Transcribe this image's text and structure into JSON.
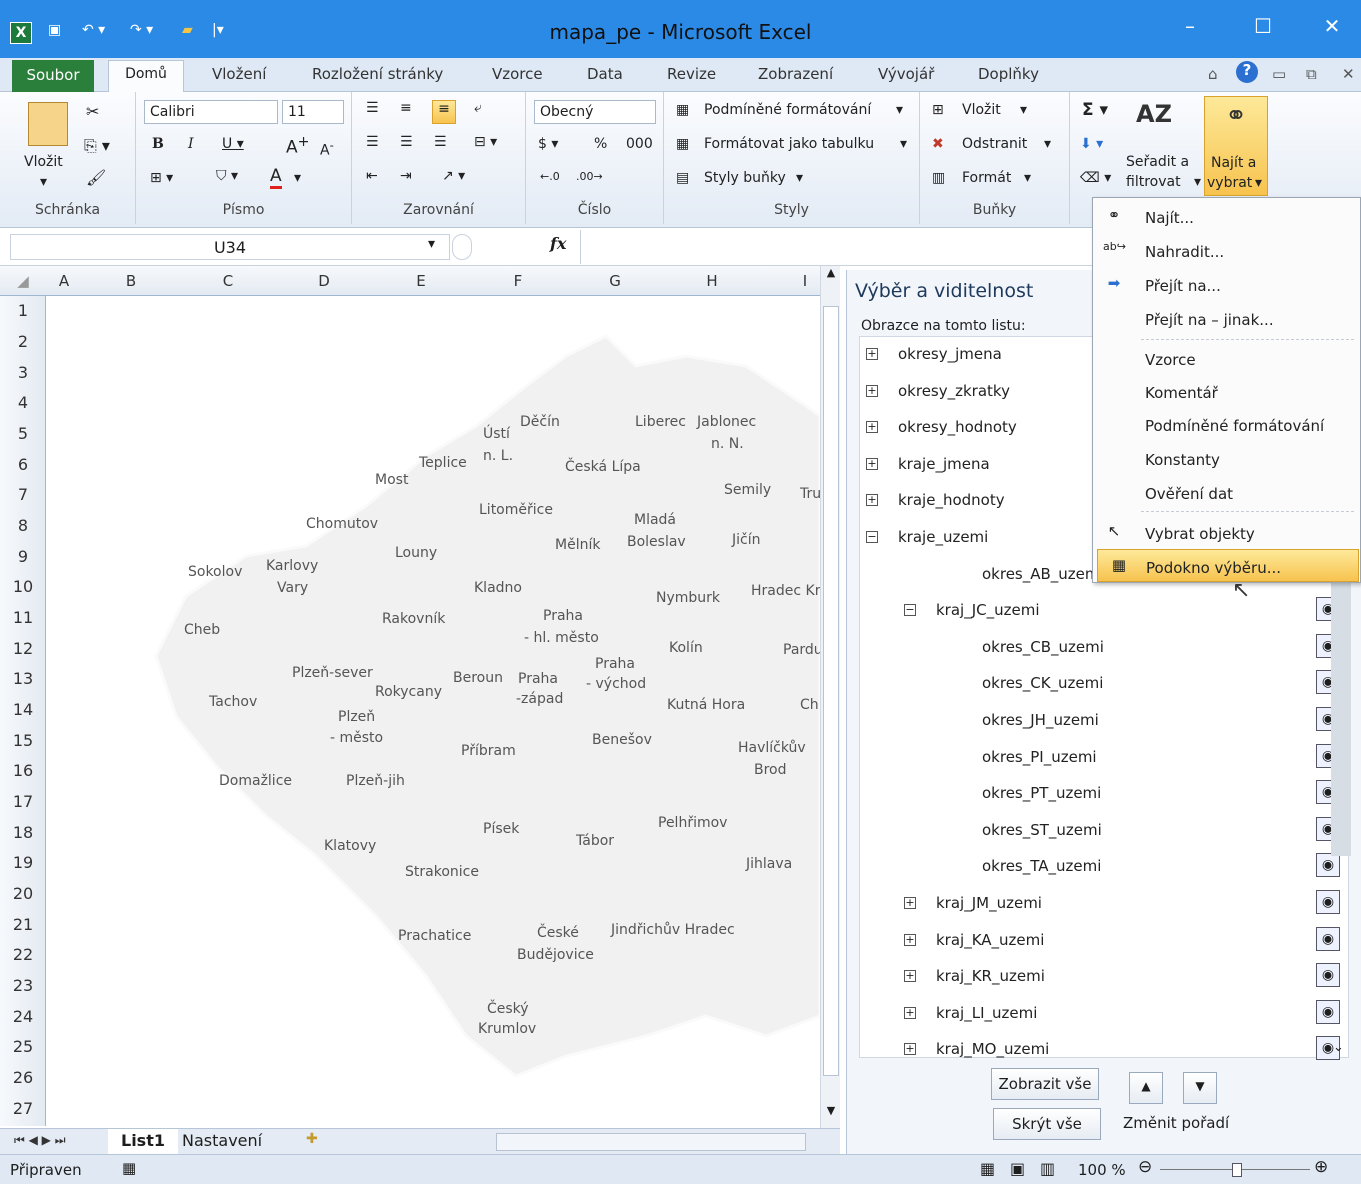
{
  "window": {
    "title": "mapa_pe  -  Microsoft Excel"
  },
  "tabs": [
    "Soubor",
    "Domů",
    "Vložení",
    "Rozložení stránky",
    "Vzorce",
    "Data",
    "Revize",
    "Zobrazení",
    "Vývojář",
    "Doplňky"
  ],
  "ribbon": {
    "clipboard": {
      "paste": "Vložit",
      "label": "Schránka"
    },
    "font": {
      "name": "Calibri",
      "size": "11",
      "label": "Písmo"
    },
    "alignment": {
      "label": "Zarovnání"
    },
    "number": {
      "format": "Obecný",
      "percent": "%",
      "thousands": "000",
      "label": "Číslo"
    },
    "styles": {
      "conditional": "Podmíněné formátování",
      "as_table": "Formátovat jako tabulku",
      "cell_styles": "Styly buňky",
      "label": "Styly"
    },
    "cells": {
      "insert": "Vložit",
      "delete": "Odstranit",
      "format": "Formát",
      "label": "Buňky"
    },
    "editing": {
      "sort_line1": "Seřadit a",
      "sort_line2": "filtrovat",
      "find_line1": "Najít a",
      "find_line2": "vybrat"
    }
  },
  "formula_bar": {
    "name_box": "U34",
    "fx": "fx"
  },
  "grid": {
    "columns": [
      "A",
      "B",
      "C",
      "D",
      "E",
      "F",
      "G",
      "H",
      "I"
    ],
    "rows": [
      "1",
      "2",
      "3",
      "4",
      "5",
      "6",
      "7",
      "8",
      "9",
      "10",
      "11",
      "12",
      "13",
      "14",
      "15",
      "16",
      "17",
      "18",
      "19",
      "20",
      "21",
      "22",
      "23",
      "24",
      "25",
      "26",
      "27"
    ]
  },
  "map_labels": [
    "Děčín",
    "Liberec",
    "Jablonec",
    "n. N.",
    "Ústí",
    "n. L.",
    "Teplice",
    "Česká Lípa",
    "Most",
    "Semily",
    "Tru",
    "Litoměřice",
    "Chomutov",
    "Mladá",
    "Boleslav",
    "Mělník",
    "Jičín",
    "Louny",
    "Karlovy",
    "Vary",
    "Sokolov",
    "Kladno",
    "Nymburk",
    "Hradec Kr",
    "Praha",
    "- hl. město",
    "Rakovník",
    "Cheb",
    "Kolín",
    "Pardu",
    "Praha",
    "- východ",
    "Plzeň-sever",
    "Beroun",
    "Praha",
    "-západ",
    "Rokycany",
    "Tachov",
    "Kutná Hora",
    "Ch",
    "Plzeň",
    "- město",
    "Benešov",
    "Příbram",
    "Havlíčkův",
    "Brod",
    "Domažlice",
    "Plzeň-jih",
    "Pelhřimov",
    "Písek",
    "Tábor",
    "Klatovy",
    "Jihlava",
    "Strakonice",
    "Prachatice",
    "České",
    "Budějovice",
    "Jindřichův Hradec",
    "Český",
    "Krumlov"
  ],
  "sheets": [
    "List1",
    "Nastavení"
  ],
  "status": {
    "ready": "Připraven",
    "zoom": "100 %"
  },
  "selection_pane": {
    "title": "Výběr a viditelnost",
    "subtitle": "Obrazce na tomto listu:",
    "items": [
      {
        "label": "okresy_jmena",
        "expander": "+"
      },
      {
        "label": "okresy_zkratky",
        "expander": "+"
      },
      {
        "label": "okresy_hodnoty",
        "expander": "+"
      },
      {
        "label": "kraje_jmena",
        "expander": "+"
      },
      {
        "label": "kraje_hodnoty",
        "expander": "+"
      },
      {
        "label": "kraje_uzemi",
        "expander": "−"
      },
      {
        "label": "okres_AB_uzemi",
        "expander": ""
      },
      {
        "label": "kraj_JC_uzemi",
        "expander": "−"
      },
      {
        "label": "okres_CB_uzemi",
        "expander": ""
      },
      {
        "label": "okres_CK_uzemi",
        "expander": ""
      },
      {
        "label": "okres_JH_uzemi",
        "expander": ""
      },
      {
        "label": "okres_PI_uzemi",
        "expander": ""
      },
      {
        "label": "okres_PT_uzemi",
        "expander": ""
      },
      {
        "label": "okres_ST_uzemi",
        "expander": ""
      },
      {
        "label": "okres_TA_uzemi",
        "expander": ""
      },
      {
        "label": "kraj_JM_uzemi",
        "expander": "+"
      },
      {
        "label": "kraj_KA_uzemi",
        "expander": "+"
      },
      {
        "label": "kraj_KR_uzemi",
        "expander": "+"
      },
      {
        "label": "kraj_LI_uzemi",
        "expander": "+"
      },
      {
        "label": "kraj_MO_uzemi",
        "expander": "+"
      }
    ],
    "show_all": "Zobrazit vše",
    "hide_all": "Skrýt vše",
    "reorder": "Změnit pořadí"
  },
  "dropdown": {
    "items": [
      "Najít...",
      "Nahradit...",
      "Přejít na...",
      "Přejít na – jinak...",
      "Vzorce",
      "Komentář",
      "Podmíněné formátování",
      "Konstanty",
      "Ověření dat",
      "Vybrat objekty",
      "Podokno výběru..."
    ]
  },
  "colors": {
    "title_bar": "#2b8ae6",
    "file_tab": "#2a7f3a",
    "highlight": "#f9d46b",
    "map_fill": "#f1f1f1"
  }
}
